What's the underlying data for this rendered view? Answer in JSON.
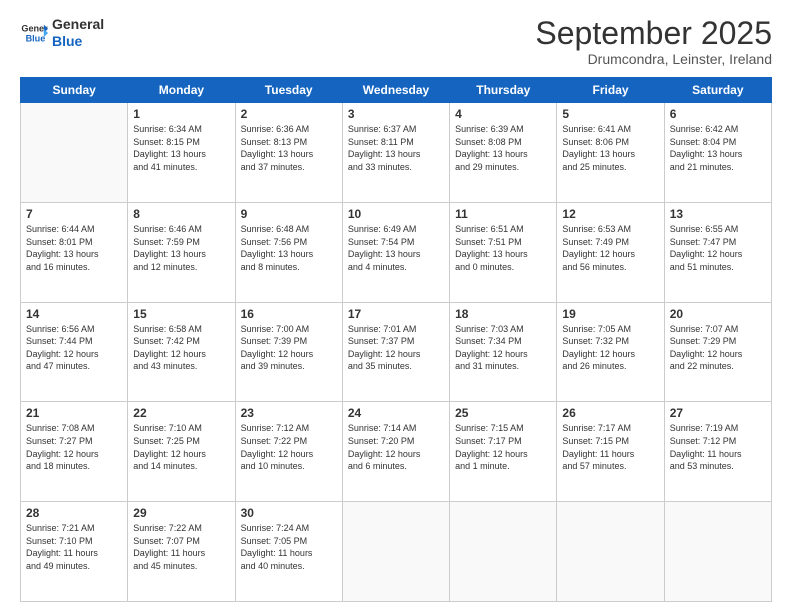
{
  "logo": {
    "line1": "General",
    "line2": "Blue"
  },
  "title": "September 2025",
  "subtitle": "Drumcondra, Leinster, Ireland",
  "weekdays": [
    "Sunday",
    "Monday",
    "Tuesday",
    "Wednesday",
    "Thursday",
    "Friday",
    "Saturday"
  ],
  "weeks": [
    [
      {
        "day": "",
        "info": ""
      },
      {
        "day": "1",
        "info": "Sunrise: 6:34 AM\nSunset: 8:15 PM\nDaylight: 13 hours\nand 41 minutes."
      },
      {
        "day": "2",
        "info": "Sunrise: 6:36 AM\nSunset: 8:13 PM\nDaylight: 13 hours\nand 37 minutes."
      },
      {
        "day": "3",
        "info": "Sunrise: 6:37 AM\nSunset: 8:11 PM\nDaylight: 13 hours\nand 33 minutes."
      },
      {
        "day": "4",
        "info": "Sunrise: 6:39 AM\nSunset: 8:08 PM\nDaylight: 13 hours\nand 29 minutes."
      },
      {
        "day": "5",
        "info": "Sunrise: 6:41 AM\nSunset: 8:06 PM\nDaylight: 13 hours\nand 25 minutes."
      },
      {
        "day": "6",
        "info": "Sunrise: 6:42 AM\nSunset: 8:04 PM\nDaylight: 13 hours\nand 21 minutes."
      }
    ],
    [
      {
        "day": "7",
        "info": "Sunrise: 6:44 AM\nSunset: 8:01 PM\nDaylight: 13 hours\nand 16 minutes."
      },
      {
        "day": "8",
        "info": "Sunrise: 6:46 AM\nSunset: 7:59 PM\nDaylight: 13 hours\nand 12 minutes."
      },
      {
        "day": "9",
        "info": "Sunrise: 6:48 AM\nSunset: 7:56 PM\nDaylight: 13 hours\nand 8 minutes."
      },
      {
        "day": "10",
        "info": "Sunrise: 6:49 AM\nSunset: 7:54 PM\nDaylight: 13 hours\nand 4 minutes."
      },
      {
        "day": "11",
        "info": "Sunrise: 6:51 AM\nSunset: 7:51 PM\nDaylight: 13 hours\nand 0 minutes."
      },
      {
        "day": "12",
        "info": "Sunrise: 6:53 AM\nSunset: 7:49 PM\nDaylight: 12 hours\nand 56 minutes."
      },
      {
        "day": "13",
        "info": "Sunrise: 6:55 AM\nSunset: 7:47 PM\nDaylight: 12 hours\nand 51 minutes."
      }
    ],
    [
      {
        "day": "14",
        "info": "Sunrise: 6:56 AM\nSunset: 7:44 PM\nDaylight: 12 hours\nand 47 minutes."
      },
      {
        "day": "15",
        "info": "Sunrise: 6:58 AM\nSunset: 7:42 PM\nDaylight: 12 hours\nand 43 minutes."
      },
      {
        "day": "16",
        "info": "Sunrise: 7:00 AM\nSunset: 7:39 PM\nDaylight: 12 hours\nand 39 minutes."
      },
      {
        "day": "17",
        "info": "Sunrise: 7:01 AM\nSunset: 7:37 PM\nDaylight: 12 hours\nand 35 minutes."
      },
      {
        "day": "18",
        "info": "Sunrise: 7:03 AM\nSunset: 7:34 PM\nDaylight: 12 hours\nand 31 minutes."
      },
      {
        "day": "19",
        "info": "Sunrise: 7:05 AM\nSunset: 7:32 PM\nDaylight: 12 hours\nand 26 minutes."
      },
      {
        "day": "20",
        "info": "Sunrise: 7:07 AM\nSunset: 7:29 PM\nDaylight: 12 hours\nand 22 minutes."
      }
    ],
    [
      {
        "day": "21",
        "info": "Sunrise: 7:08 AM\nSunset: 7:27 PM\nDaylight: 12 hours\nand 18 minutes."
      },
      {
        "day": "22",
        "info": "Sunrise: 7:10 AM\nSunset: 7:25 PM\nDaylight: 12 hours\nand 14 minutes."
      },
      {
        "day": "23",
        "info": "Sunrise: 7:12 AM\nSunset: 7:22 PM\nDaylight: 12 hours\nand 10 minutes."
      },
      {
        "day": "24",
        "info": "Sunrise: 7:14 AM\nSunset: 7:20 PM\nDaylight: 12 hours\nand 6 minutes."
      },
      {
        "day": "25",
        "info": "Sunrise: 7:15 AM\nSunset: 7:17 PM\nDaylight: 12 hours\nand 1 minute."
      },
      {
        "day": "26",
        "info": "Sunrise: 7:17 AM\nSunset: 7:15 PM\nDaylight: 11 hours\nand 57 minutes."
      },
      {
        "day": "27",
        "info": "Sunrise: 7:19 AM\nSunset: 7:12 PM\nDaylight: 11 hours\nand 53 minutes."
      }
    ],
    [
      {
        "day": "28",
        "info": "Sunrise: 7:21 AM\nSunset: 7:10 PM\nDaylight: 11 hours\nand 49 minutes."
      },
      {
        "day": "29",
        "info": "Sunrise: 7:22 AM\nSunset: 7:07 PM\nDaylight: 11 hours\nand 45 minutes."
      },
      {
        "day": "30",
        "info": "Sunrise: 7:24 AM\nSunset: 7:05 PM\nDaylight: 11 hours\nand 40 minutes."
      },
      {
        "day": "",
        "info": ""
      },
      {
        "day": "",
        "info": ""
      },
      {
        "day": "",
        "info": ""
      },
      {
        "day": "",
        "info": ""
      }
    ]
  ]
}
